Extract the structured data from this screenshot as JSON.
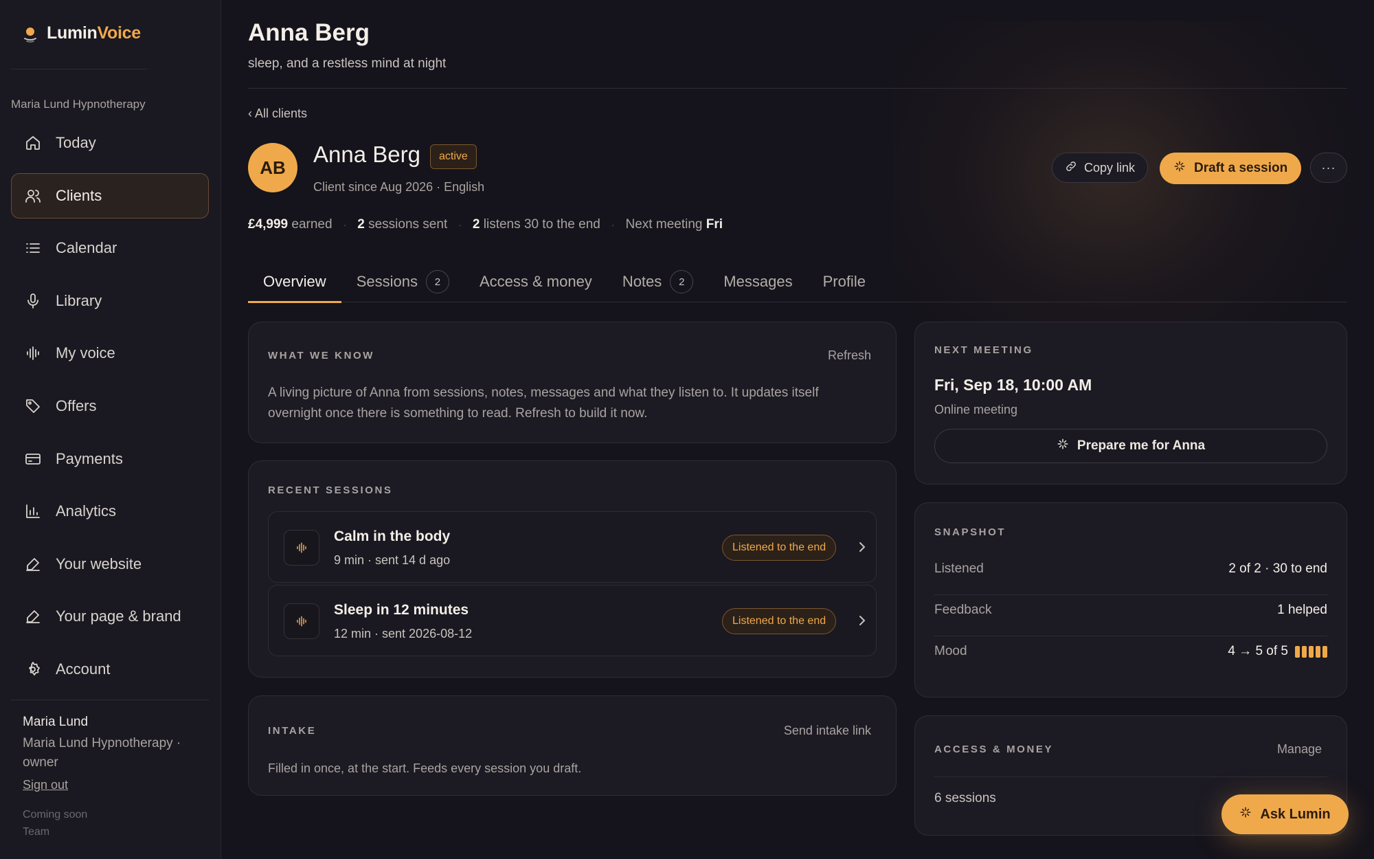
{
  "brand": {
    "name_part1": "Lumin",
    "name_part2": "Voice",
    "accent_color": "#f0a94a"
  },
  "sidebar": {
    "org": "Maria Lund Hypnotherapy",
    "items": [
      {
        "label": "Today",
        "icon": "home-icon"
      },
      {
        "label": "Clients",
        "icon": "users-icon",
        "active": true
      },
      {
        "label": "Calendar",
        "icon": "list-icon"
      },
      {
        "label": "Library",
        "icon": "microphone-icon"
      },
      {
        "label": "My voice",
        "icon": "waveform-icon"
      },
      {
        "label": "Offers",
        "icon": "tag-icon"
      },
      {
        "label": "Payments",
        "icon": "credit-card-icon"
      },
      {
        "label": "Analytics",
        "icon": "bar-chart-icon"
      },
      {
        "label": "Your website",
        "icon": "edit-icon"
      },
      {
        "label": "Your page & brand",
        "icon": "edit-icon"
      },
      {
        "label": "Account",
        "icon": "gear-icon"
      }
    ],
    "user": {
      "name": "Maria Lund",
      "org_role": "Maria Lund Hypnotherapy · owner",
      "sign_out": "Sign out"
    },
    "coming_soon": "Coming soon",
    "team": "Team"
  },
  "header": {
    "title": "Anna Berg",
    "subtitle": "sleep, and a restless mind at night"
  },
  "back_link": "‹ All clients",
  "client": {
    "initials": "AB",
    "name": "Anna Berg",
    "status": "active",
    "meta": "Client since Aug 2026 · English"
  },
  "actions": {
    "copy_link": "Copy link",
    "draft_session": "Draft a session",
    "more": "···"
  },
  "stats": {
    "earned_value": "£4,999",
    "earned_label": "earned",
    "sessions_value": "2",
    "sessions_label": "sessions sent",
    "listens_value": "2",
    "listens_label": "listens 30 to the end",
    "meeting_label": "Next meeting",
    "meeting_value": "Fri"
  },
  "tabs": [
    {
      "label": "Overview",
      "active": true
    },
    {
      "label": "Sessions",
      "count": "2"
    },
    {
      "label": "Access & money"
    },
    {
      "label": "Notes",
      "count": "2"
    },
    {
      "label": "Messages"
    },
    {
      "label": "Profile"
    }
  ],
  "what_we_know": {
    "title": "WHAT WE KNOW",
    "action": "Refresh",
    "text": "A living picture of Anna from sessions, notes, messages and what they listen to. It updates itself overnight once there is something to read. Refresh to build it now."
  },
  "recent_sessions": {
    "title": "RECENT SESSIONS",
    "items": [
      {
        "title": "Calm in the body",
        "meta": "9 min · sent 14 d ago",
        "badge": "Listened to the end"
      },
      {
        "title": "Sleep in 12 minutes",
        "meta": "12 min · sent 2026-08-12",
        "badge": "Listened to the end"
      }
    ]
  },
  "intake": {
    "title": "INTAKE",
    "action": "Send intake link",
    "text": "Filled in once, at the start. Feeds every session you draft."
  },
  "next_meeting": {
    "title": "NEXT MEETING",
    "date": "Fri, Sep 18, 10:00 AM",
    "type": "Online meeting",
    "prepare": "Prepare me for Anna"
  },
  "snapshot": {
    "title": "SNAPSHOT",
    "rows": [
      {
        "label": "Listened",
        "value": "2 of 2 · 30 to end"
      },
      {
        "label": "Feedback",
        "value": "1 helped"
      },
      {
        "label": "Mood",
        "value": "4 → 5 of 5",
        "level": 5,
        "max": 5
      }
    ]
  },
  "access_money": {
    "title": "ACCESS & MONEY",
    "action": "Manage",
    "row_label": "6 sessions"
  },
  "ask": {
    "label": "Ask Lumin"
  }
}
